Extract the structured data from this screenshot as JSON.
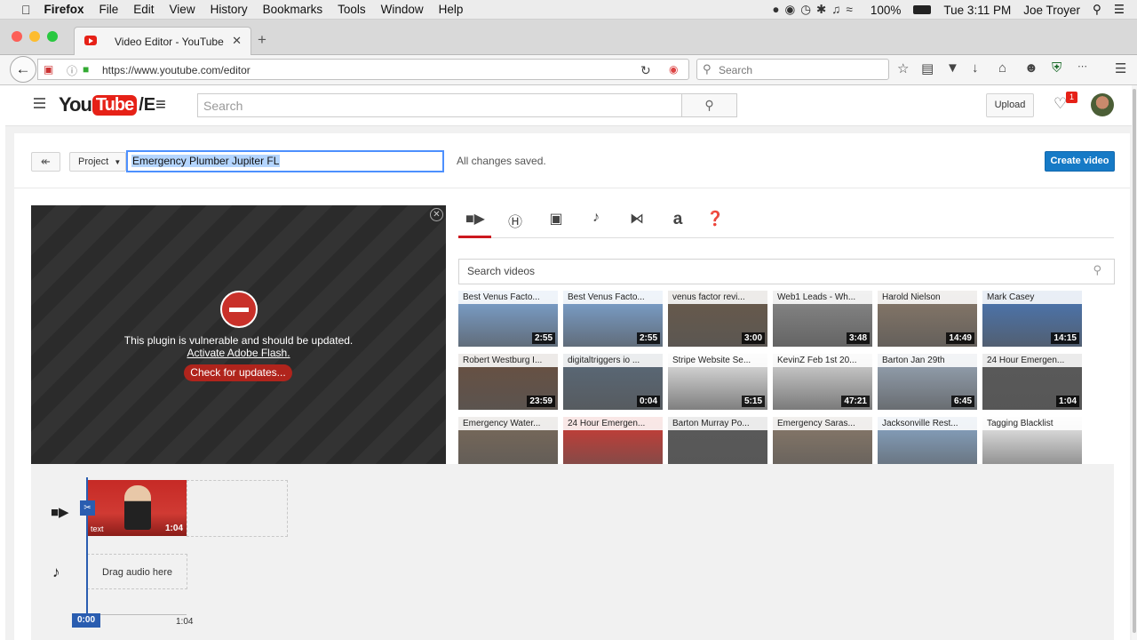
{
  "menubar": {
    "app": "Firefox",
    "items": [
      "File",
      "Edit",
      "View",
      "History",
      "Bookmarks",
      "Tools",
      "Window",
      "Help"
    ],
    "battery": "100%",
    "clock": "Tue 3:11 PM",
    "user": "Joe Troyer"
  },
  "browser": {
    "tab_title": "Video Editor - YouTube",
    "url": "https://www.youtube.com/editor",
    "search_placeholder": "Search"
  },
  "youtube": {
    "logo_you": "You",
    "logo_tube": "Tube",
    "logo_suffix": "/E≡",
    "search_placeholder": "Search",
    "upload_label": "Upload",
    "notification_count": "1"
  },
  "editor": {
    "project_label": "Project",
    "title": "Emergency Plumber Jupiter FL",
    "status": "All changes saved.",
    "create_label": "Create video"
  },
  "player": {
    "message": "This plugin is vulnerable and should be updated.",
    "activate_link": "Activate Adobe Flash.",
    "update_button": "Check for updates..."
  },
  "media": {
    "tabs": [
      "video-camera-icon",
      "captions-icon",
      "photo-camera-icon",
      "music-note-icon",
      "transitions-icon",
      "text-icon",
      "help-icon"
    ],
    "search_placeholder": "Search videos",
    "videos": [
      {
        "title": "Best Venus Facto...",
        "duration": "2:55",
        "color": "#7fa8d8"
      },
      {
        "title": "Best Venus Facto...",
        "duration": "2:55",
        "color": "#7fa8d8"
      },
      {
        "title": "venus factor revi...",
        "duration": "3:00",
        "color": "#6a5a4a"
      },
      {
        "title": "Web1 Leads - Wh...",
        "duration": "3:48",
        "color": "#8a8a8a"
      },
      {
        "title": "Harold Nielson",
        "duration": "14:49",
        "color": "#8a7a6a"
      },
      {
        "title": "Mark Casey",
        "duration": "14:15",
        "color": "#4a78b8"
      },
      {
        "title": "Robert Westburg I...",
        "duration": "23:59",
        "color": "#6a5040"
      },
      {
        "title": "digitaltriggers io ...",
        "duration": "0:04",
        "color": "#5a6a7a"
      },
      {
        "title": "Stripe Website Se...",
        "duration": "5:15",
        "color": "#e8e8e8"
      },
      {
        "title": "KevinZ Feb 1st 20...",
        "duration": "47:21",
        "color": "#d8d8d8"
      },
      {
        "title": "Barton Jan 29th",
        "duration": "6:45",
        "color": "#9aa8b8"
      },
      {
        "title": "24 Hour Emergen...",
        "duration": "1:04",
        "color": "#5a5a5a"
      },
      {
        "title": "Emergency Water...",
        "duration": "",
        "color": "#7a6a5a"
      },
      {
        "title": "24 Hour Emergen...",
        "duration": "",
        "color": "#d03a33"
      },
      {
        "title": "Barton Murray Po...",
        "duration": "",
        "color": "#5a5a5a"
      },
      {
        "title": "Emergency Saras...",
        "duration": "",
        "color": "#8a7a6a"
      },
      {
        "title": "Jacksonville Rest...",
        "duration": "",
        "color": "#8aa8c8"
      },
      {
        "title": "Tagging Blacklist",
        "duration": "",
        "color": "#f0f0f0"
      }
    ]
  },
  "timeline": {
    "clip_label": "text",
    "clip_duration": "1:04",
    "audio_drop": "Drag audio here",
    "time_start": "0:00",
    "time_end": "1:04"
  }
}
